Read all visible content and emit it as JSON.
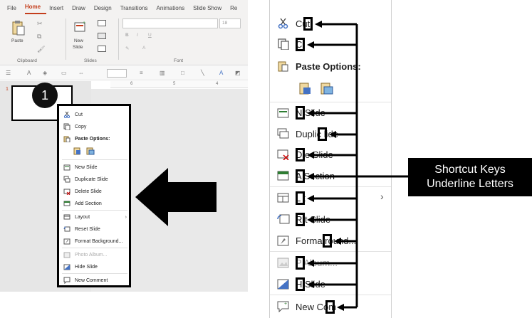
{
  "ribbon": {
    "tabs": [
      "File",
      "Home",
      "Insert",
      "Draw",
      "Design",
      "Transitions",
      "Animations",
      "Slide Show",
      "Re"
    ],
    "active_tab": "Home",
    "groups": {
      "clipboard": "Clipboard",
      "slides": "Slides",
      "font": "Font"
    },
    "paste_label": "Paste",
    "new_slide_label": "New",
    "new_slide_label2": "Slide",
    "font_size": "18",
    "ruler_ticks": [
      "6",
      "5",
      "4"
    ]
  },
  "thumbnail": {
    "slide_number": "1",
    "badge": "1"
  },
  "small_menu": {
    "items": [
      {
        "label": "Cut",
        "icon": "scissors-icon"
      },
      {
        "label": "Copy",
        "icon": "copy-icon"
      },
      {
        "label": "Paste Options:",
        "icon": "paste-icon"
      },
      {
        "label": "New Slide",
        "icon": "new-slide-icon"
      },
      {
        "label": "Duplicate Slide",
        "icon": "duplicate-slide-icon"
      },
      {
        "label": "Delete Slide",
        "icon": "delete-slide-icon"
      },
      {
        "label": "Add Section",
        "icon": "add-section-icon"
      },
      {
        "label": "Layout",
        "icon": "layout-icon"
      },
      {
        "label": "Reset Slide",
        "icon": "reset-slide-icon"
      },
      {
        "label": "Format Background...",
        "icon": "format-background-icon"
      },
      {
        "label": "Photo Album...",
        "icon": "photo-album-icon"
      },
      {
        "label": "Hide Slide",
        "icon": "hide-slide-icon"
      },
      {
        "label": "New Comment",
        "icon": "comment-icon"
      }
    ]
  },
  "big_menu": {
    "items": [
      {
        "label": "Cut"
      },
      {
        "label": "C"
      },
      {
        "label": "Paste Options:"
      },
      {
        "label": "N      Slide"
      },
      {
        "label": "Duplic         lide"
      },
      {
        "label": "D      e Slide"
      },
      {
        "label": "A      Section"
      },
      {
        "label": "L       t"
      },
      {
        "label": "R      t Slide"
      },
      {
        "label": "Forma          round..."
      },
      {
        "label": "P      Album..."
      },
      {
        "label": "H      Slide"
      },
      {
        "label": "New Com"
      }
    ],
    "chevron": "›"
  },
  "callout": {
    "line1": "Shortcut Keys",
    "line2": "Underline Letters"
  },
  "colors": {
    "accent": "#c43e1c",
    "callout_bg": "#000000",
    "pane_gray": "#e6e6e6"
  }
}
